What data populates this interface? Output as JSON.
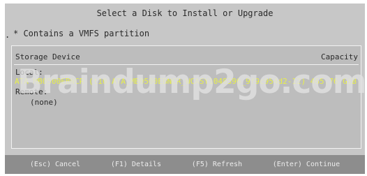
{
  "dialog": {
    "title": "Select a Disk to Install or Upgrade",
    "legend": "* Contains a VMFS partition",
    "left_marker": "."
  },
  "table": {
    "col_device": "Storage Device",
    "col_capacity": "Capacity",
    "local_label": "Local:",
    "selected_disk": {
      "name": "ATA MB0500EBNCR (t10.ATA_MB0500EBNCR_WCASY1048396_9f9c954d2-12)",
      "capacity": "465.76 GiB"
    },
    "remote_label": "Remote:",
    "remote_none": "(none)"
  },
  "watermark": "Braindump2go.com",
  "footer": {
    "cancel": "(Esc) Cancel",
    "details": "(F1) Details",
    "refresh": "(F5) Refresh",
    "continue": "(Enter) Continue"
  },
  "colors": {
    "dialog_bg": "#c7c7c7",
    "footer_bg": "#8d8d8d",
    "selected_text": "#e8f04a"
  }
}
